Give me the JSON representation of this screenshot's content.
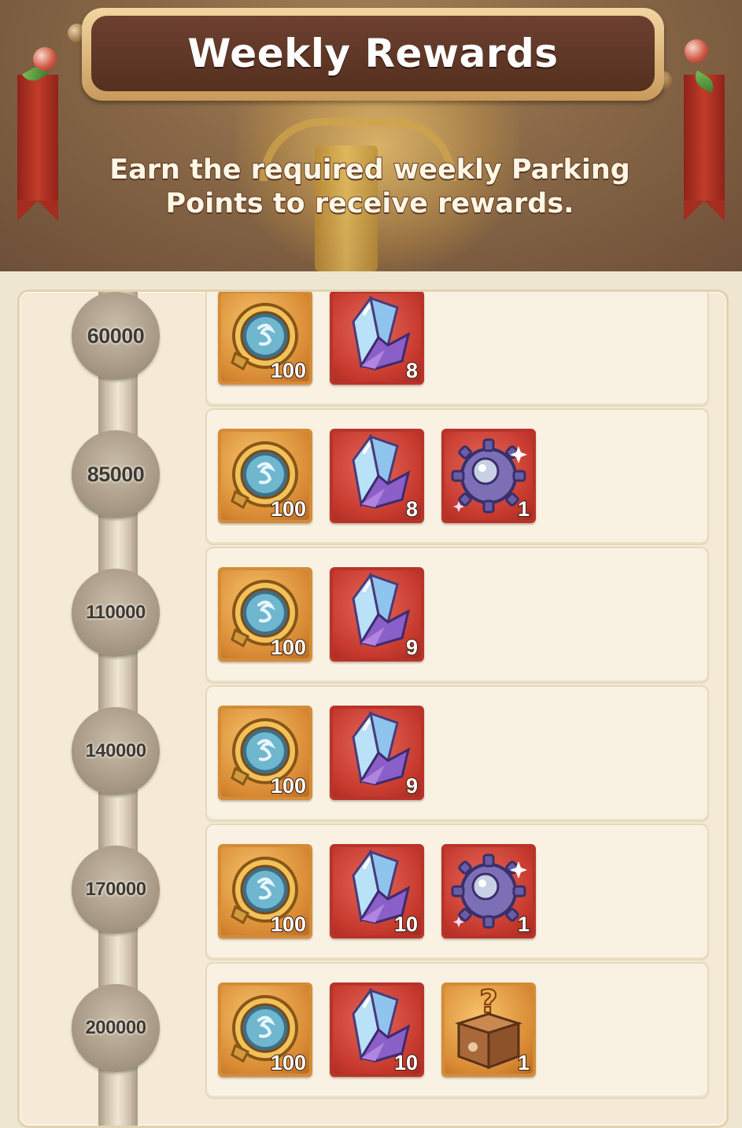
{
  "header": {
    "title": "Weekly Rewards",
    "subtitle": "Earn the required weekly Parking Points to receive rewards."
  },
  "tiers": [
    {
      "points": "60000",
      "rewards": [
        {
          "icon": "portal-coin-icon",
          "qty": "100"
        },
        {
          "icon": "crystal-icon",
          "qty": "8"
        }
      ]
    },
    {
      "points": "85000",
      "rewards": [
        {
          "icon": "portal-coin-icon",
          "qty": "100"
        },
        {
          "icon": "crystal-icon",
          "qty": "8"
        },
        {
          "icon": "gear-ore-icon",
          "qty": "1"
        }
      ]
    },
    {
      "points": "110000",
      "rewards": [
        {
          "icon": "portal-coin-icon",
          "qty": "100"
        },
        {
          "icon": "crystal-icon",
          "qty": "9"
        }
      ]
    },
    {
      "points": "140000",
      "rewards": [
        {
          "icon": "portal-coin-icon",
          "qty": "100"
        },
        {
          "icon": "crystal-icon",
          "qty": "9"
        }
      ]
    },
    {
      "points": "170000",
      "rewards": [
        {
          "icon": "portal-coin-icon",
          "qty": "100"
        },
        {
          "icon": "crystal-icon",
          "qty": "10"
        },
        {
          "icon": "gear-ore-icon",
          "qty": "1"
        }
      ]
    },
    {
      "points": "200000",
      "rewards": [
        {
          "icon": "portal-coin-icon",
          "qty": "100"
        },
        {
          "icon": "crystal-icon",
          "qty": "10"
        },
        {
          "icon": "mystery-box-icon",
          "qty": "1"
        }
      ]
    }
  ]
}
